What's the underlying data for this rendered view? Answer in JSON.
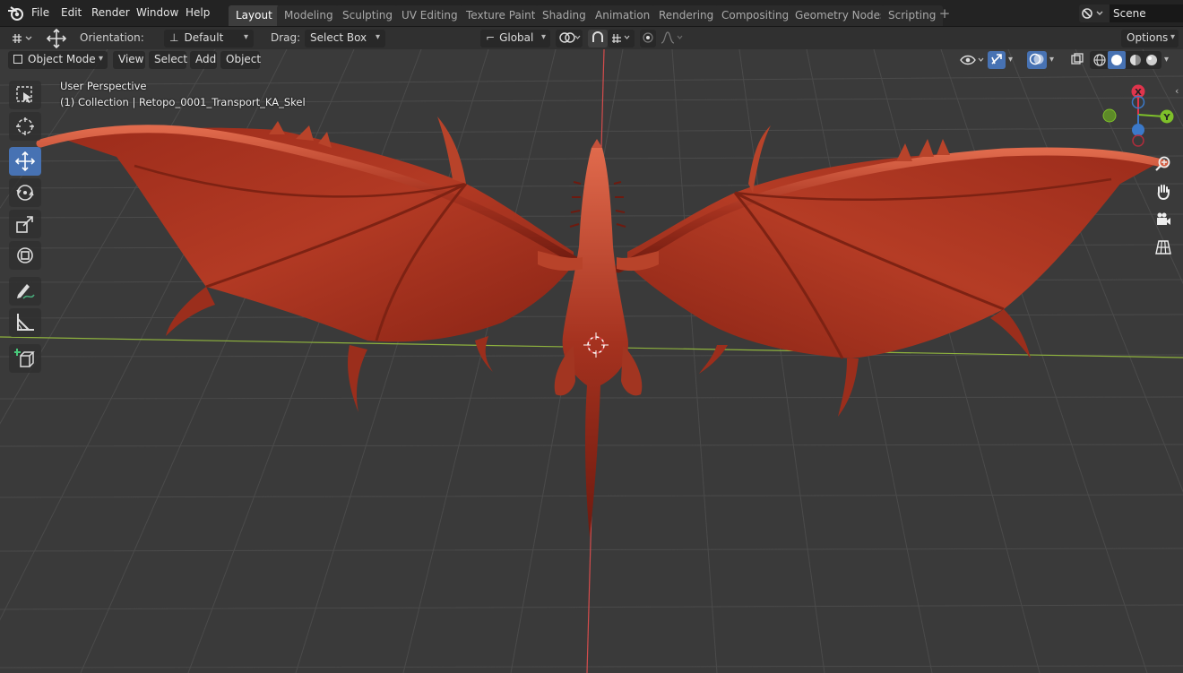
{
  "topbar": {
    "menus": [
      "File",
      "Edit",
      "Render",
      "Window",
      "Help"
    ],
    "workspaces": [
      "Layout",
      "Modeling",
      "Sculpting",
      "UV Editing",
      "Texture Paint",
      "Shading",
      "Animation",
      "Rendering",
      "Compositing",
      "Geometry Nodes",
      "Scripting"
    ],
    "active_workspace": "Layout",
    "scene_icon": "scene-icon",
    "scene_name": "Scene"
  },
  "tool_header": {
    "orientation_label": "Orientation:",
    "orientation_value": "Default",
    "drag_label": "Drag:",
    "drag_value": "Select Box",
    "transform_orientation": "Global",
    "options_label": "Options"
  },
  "viewport_header": {
    "mode": "Object Mode",
    "menus": [
      "View",
      "Select",
      "Add",
      "Object"
    ]
  },
  "viewport_overlay": {
    "perspective": "User Perspective",
    "collection": "(1) Collection | Retopo_0001_Transport_KA_Skel"
  },
  "gizmo": {
    "x_label": "X",
    "y_label": "Y",
    "x_color": "#e0344c",
    "y_color": "#7ec02a",
    "z_color": "#3b79c9"
  },
  "toolbar_tools": [
    "select-box-icon",
    "cursor-icon",
    "move-icon",
    "rotate-icon",
    "scale-icon",
    "transform-icon",
    "annotate-icon",
    "measure-icon",
    "add-cube-icon"
  ],
  "active_tool": "move-icon",
  "nav_buttons": [
    "zoom-icon",
    "pan-hand-icon",
    "camera-icon",
    "ortho-grid-icon"
  ],
  "colors": {
    "accent": "#4772b3",
    "dragon": "#a5321f",
    "x_axis_line": "#d74c4c",
    "y_axis_line": "#8bb23a"
  }
}
